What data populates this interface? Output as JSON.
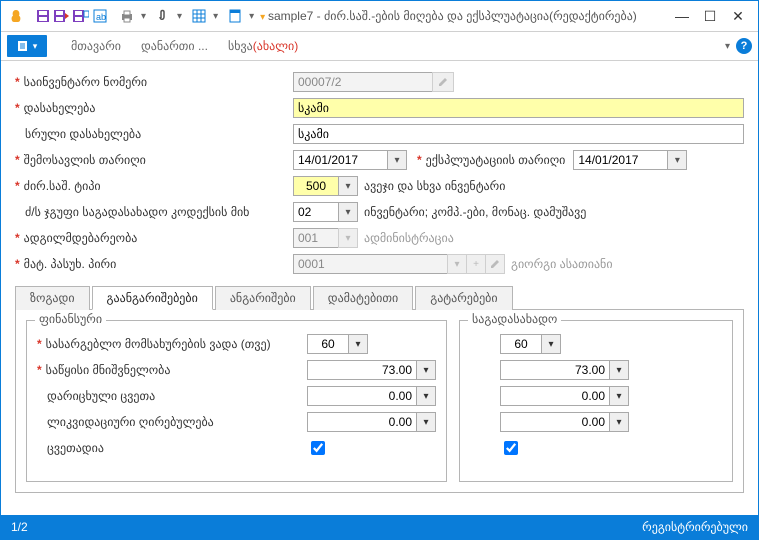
{
  "title_prefix": "sample7 - ",
  "title_main": "ძირ.საშ.-ების მიღება და ექსპლუატაცია(რედაქტირება)",
  "menu": {
    "main": "მთავარი",
    "attach": "დანართი ...",
    "other": "სხვა",
    "other_new": "(ახალი)"
  },
  "labels": {
    "inv_no": "საინვენტარო ნომერი",
    "name": "დასახელება",
    "full_name": "სრული დასახელება",
    "income_date": "შემოსავლის თარიღი",
    "expl_date": "ექსპლუატაციის თარიღი",
    "type": "ძირ.საშ. ტიპი",
    "tax_group": "ძ/ს ჯგუფი საგადასახადო კოდექსის მიხ",
    "location": "ადგილმდებარეობა",
    "resp_person": "მატ. პასუხ. პირი"
  },
  "values": {
    "inv_no": "00007/2",
    "name": "სკამი",
    "full_name": "სკამი",
    "income_date": "14/01/2017",
    "expl_date": "14/01/2017",
    "type_code": "500",
    "type_text": "ავეჯი და სხვა ინვენტარი",
    "tax_code": "02",
    "tax_text": "ინვენტარი; კომპ.-ები, მონაც. დამუშავე",
    "loc_code": "001",
    "loc_text": "ადმინისტრაცია",
    "resp_code": "0001",
    "resp_text": "გიორგი ასათიანი"
  },
  "tabs": {
    "general": "ზოგადი",
    "calc": "გაანგარიშებები",
    "accounts": "ანგარიშები",
    "additional": "დამატებითი",
    "ops": "გატარებები"
  },
  "fin_group": "ფინანსური",
  "tax_group": "საგადასახადო",
  "fin_rows": {
    "useful_life": "სასარგებლო მომსახურების ვადა (თვე)",
    "initial_value": "საწყისი მნიშვნელობა",
    "accum_depr": "დარიცხული ცვეთა",
    "liquidation": "ლიკვიდაციური ღირებულება",
    "depreciable": "ცვეთადია"
  },
  "fin_vals": {
    "months": "60",
    "initial": "73.00",
    "accum": "0.00",
    "liq": "0.00"
  },
  "tax_vals": {
    "months": "60",
    "initial": "73.00",
    "accum": "0.00",
    "liq": "0.00"
  },
  "status_left": "1/2",
  "status_right": "რეგისტრირებული"
}
